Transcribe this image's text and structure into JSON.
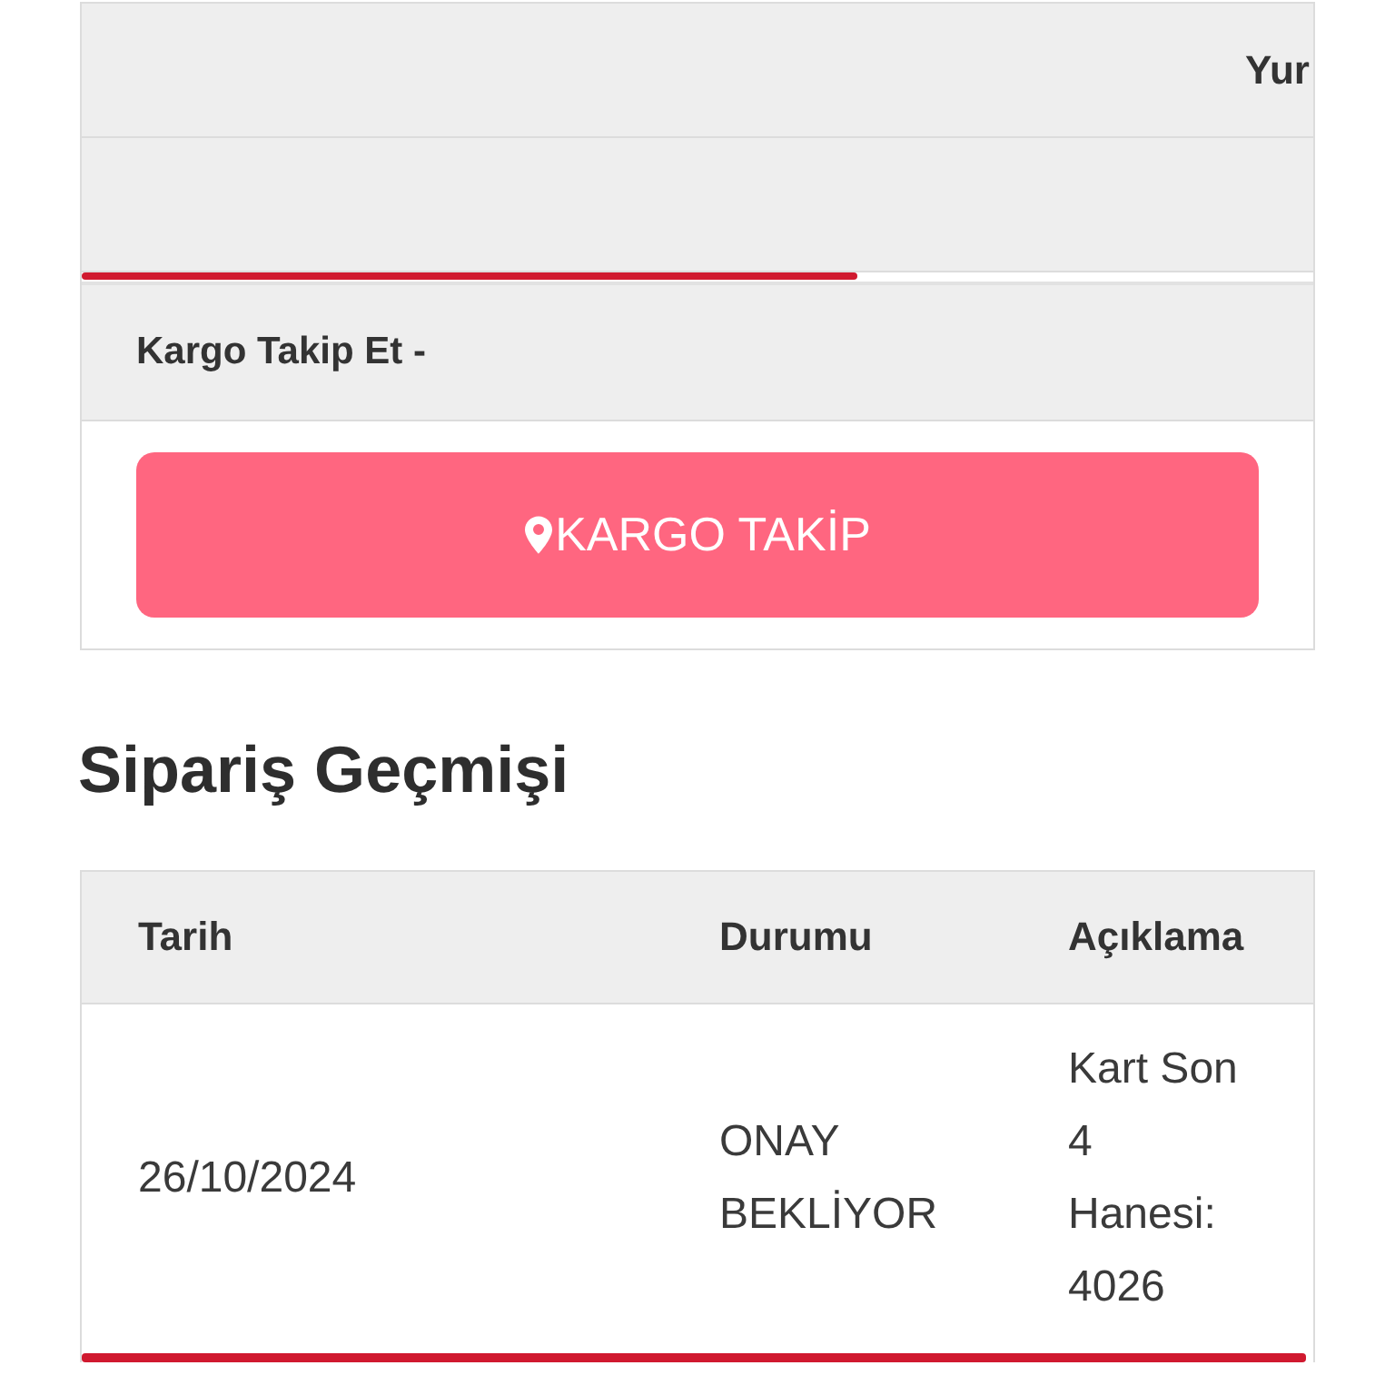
{
  "tracking_table": {
    "header_cell": "Yur"
  },
  "tracking": {
    "title": "Kargo Takip Et -",
    "button": {
      "label": "KARGO TAKİP"
    }
  },
  "order_history": {
    "title": "Sipariş Geçmişi",
    "columns": [
      "Tarih",
      "Durumu",
      "Açıklama"
    ],
    "rows": [
      [
        "26/10/2024",
        "ONAY BEKLİYOR",
        "Kart Son 4 Hanesi: 4026"
      ]
    ]
  }
}
